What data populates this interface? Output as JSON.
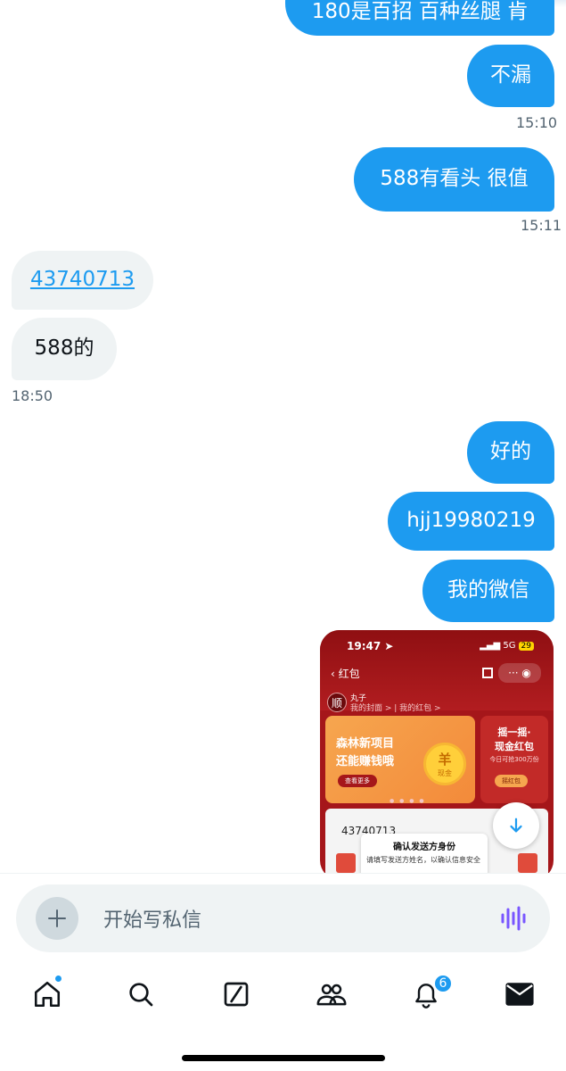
{
  "messages": {
    "m0": {
      "text": "180是百招 百种丝腿 肯",
      "direction": "sent"
    },
    "m1": {
      "text": "不漏",
      "direction": "sent",
      "time": "15:10"
    },
    "m2": {
      "text": "588有看头 很值",
      "direction": "sent",
      "time": "15:11"
    },
    "m3": {
      "text": "43740713",
      "direction": "received",
      "link": true
    },
    "m4": {
      "text": "588的",
      "direction": "received",
      "time": "18:50"
    },
    "m5": {
      "text": "好的",
      "direction": "sent"
    },
    "m6": {
      "text": "hjj19980219",
      "direction": "sent"
    },
    "m7": {
      "text": "我的微信",
      "direction": "sent"
    }
  },
  "image_preview": {
    "status_time": "19:47",
    "status_net": "5G",
    "status_battery": "29",
    "nav_back": "红包",
    "avatar_char": "顺",
    "user_name": "丸子",
    "user_links": "我的封面 > | 我的红包 >",
    "promo_line1": "森林新项目",
    "promo_line2": "还能赚钱哦",
    "promo_btn": "查看更多",
    "coin_symbol": "羊",
    "coin_label": "现金",
    "shake_line1": "摇一摇·",
    "shake_line2": "现金红包",
    "shake_sub": "今日可抢300万份",
    "shake_btn": "摇红包",
    "card_number": "43740713",
    "modal_title": "确认发送方身份",
    "modal_desc": "请填写发送方姓名，以确认信息安全"
  },
  "composer": {
    "placeholder": "开始写私信"
  },
  "tabbar": {
    "notifications_badge": "6",
    "items": [
      "home-icon",
      "search-icon",
      "grok-icon",
      "communities-icon",
      "notifications-icon",
      "messages-icon"
    ]
  },
  "colors": {
    "accent": "#1d9bf0",
    "received_bubble": "#eff3f4",
    "text_primary": "#0f1419",
    "text_secondary": "#536471"
  }
}
